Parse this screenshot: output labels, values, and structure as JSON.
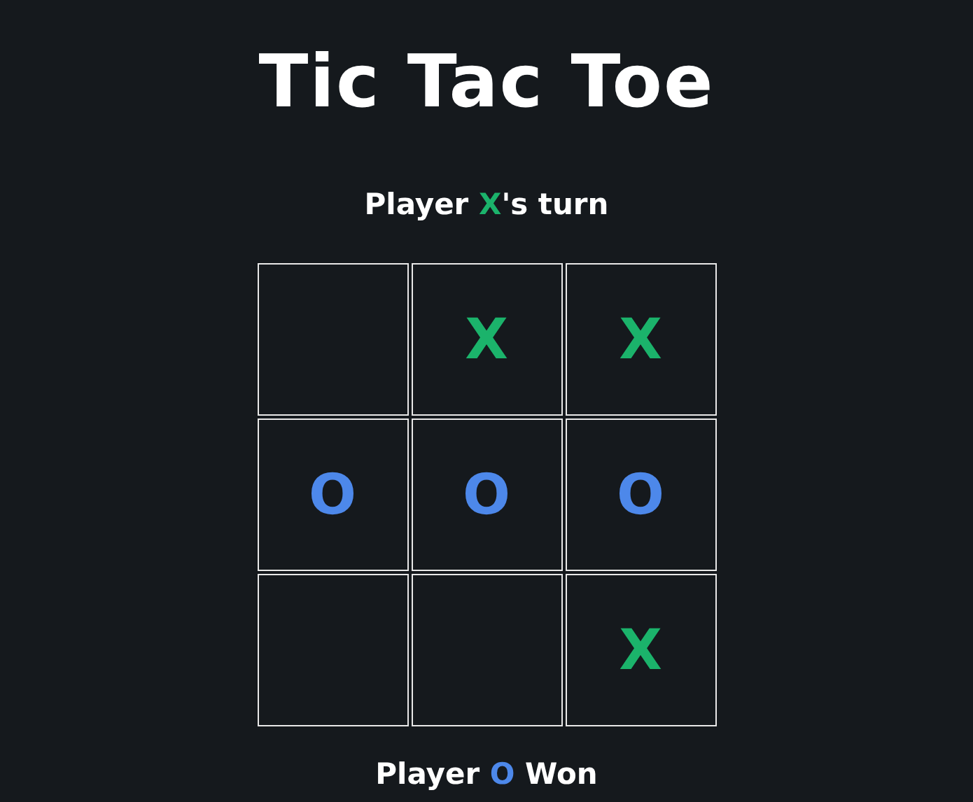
{
  "title": "Tic Tac Toe",
  "status": {
    "before": "Player ",
    "player": {
      "kind": "x",
      "text": "X"
    },
    "after": "'s turn"
  },
  "board": [
    {
      "kind": "empty"
    },
    {
      "kind": "x",
      "text": "X"
    },
    {
      "kind": "x",
      "text": "X"
    },
    {
      "kind": "o",
      "text": "O"
    },
    {
      "kind": "o",
      "text": "O"
    },
    {
      "kind": "o",
      "text": "O"
    },
    {
      "kind": "empty"
    },
    {
      "kind": "empty"
    },
    {
      "kind": "x",
      "text": "X"
    }
  ],
  "result": {
    "before": "Player ",
    "player": {
      "kind": "o",
      "text": "O"
    },
    "after": " Won"
  }
}
